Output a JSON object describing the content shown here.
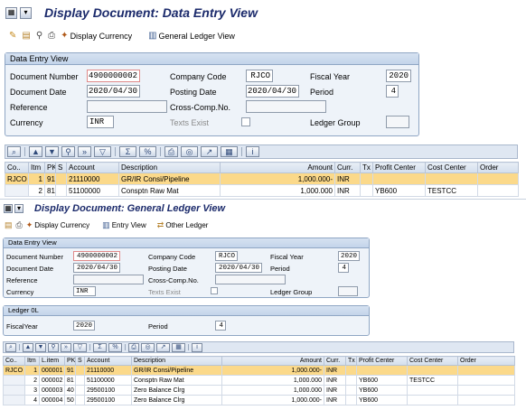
{
  "screen1": {
    "title": "Display Document: Data Entry View",
    "toolbar": {
      "display_currency": "Display Currency",
      "general_ledger_view": "General Ledger View"
    },
    "frame_title": "Data Entry View",
    "labels": {
      "document_number": "Document Number",
      "company_code": "Company Code",
      "fiscal_year": "Fiscal Year",
      "document_date": "Document Date",
      "posting_date": "Posting Date",
      "period": "Period",
      "reference": "Reference",
      "cross_comp": "Cross-Comp.No.",
      "currency": "Currency",
      "texts_exist": "Texts Exist",
      "ledger_group": "Ledger Group"
    },
    "values": {
      "document_number": "4900000002",
      "company_code": "RJCO",
      "fiscal_year": "2020",
      "document_date": "2020/04/30",
      "posting_date": "2020/04/30",
      "period": "4",
      "reference": "",
      "cross_comp": "",
      "currency": "INR",
      "ledger_group": ""
    },
    "grid": {
      "headers": [
        "Co..",
        "Itm",
        "PK",
        "S",
        "Account",
        "Description",
        "Amount",
        "Curr.",
        "Tx",
        "Profit Center",
        "Cost Center",
        "Order"
      ],
      "rows": [
        [
          "RJCO",
          "1",
          "91",
          "",
          "21110000",
          "GR/IR Consi/Pipeline",
          "1,000.000-",
          "INR",
          "",
          "",
          "",
          ""
        ],
        [
          "",
          "2",
          "81",
          "",
          "51100000",
          "Consptn Raw Mat",
          "1,000.000",
          "INR",
          "",
          "YB600",
          "TESTCC",
          ""
        ]
      ]
    }
  },
  "screen2": {
    "title": "Display Document: General Ledger View",
    "toolbar": {
      "display_currency": "Display Currency",
      "entry_view": "Entry View",
      "other_ledger": "Other Ledger"
    },
    "frame_title": "Data Entry View",
    "labels": {
      "document_number": "Document Number",
      "company_code": "Company Code",
      "fiscal_year": "Fiscal Year",
      "document_date": "Document Date",
      "posting_date": "Posting Date",
      "period": "Period",
      "reference": "Reference",
      "cross_comp": "Cross-Comp.No.",
      "currency": "Currency",
      "texts_exist": "Texts Exist",
      "ledger_group": "Ledger Group"
    },
    "values": {
      "document_number": "4900000002",
      "company_code": "RJCO",
      "fiscal_year": "2020",
      "document_date": "2020/04/30",
      "posting_date": "2020/04/30",
      "period": "4",
      "reference": "",
      "cross_comp": "",
      "currency": "INR",
      "ledger_group": ""
    },
    "ledger_frame": {
      "title": "Ledger 0L",
      "fiscal_year_label": "FiscalYear",
      "fiscal_year": "2020",
      "period_label": "Period",
      "period": "4"
    },
    "grid": {
      "headers": [
        "Co..",
        "Itm",
        "L.item",
        "PK",
        "S",
        "Account",
        "Description",
        "Amount",
        "Curr.",
        "Tx",
        "Profit Center",
        "Cost Center",
        "Order"
      ],
      "rows": [
        [
          "RJCO",
          "1",
          "000001",
          "91",
          "",
          "21110000",
          "GR/IR Consi/Pipeline",
          "1,000.000-",
          "INR",
          "",
          "",
          "",
          ""
        ],
        [
          "",
          "2",
          "000002",
          "81",
          "",
          "51100000",
          "Consptn Raw Mat",
          "1,000.000",
          "INR",
          "",
          "YB600",
          "TESTCC",
          ""
        ],
        [
          "",
          "3",
          "000003",
          "40",
          "",
          "29500100",
          "Zero Balance Clrg",
          "1,000.000",
          "INR",
          "",
          "YB600",
          "",
          ""
        ],
        [
          "",
          "4",
          "000004",
          "50",
          "",
          "29500100",
          "Zero Balance Clrg",
          "1,000.000-",
          "INR",
          "",
          "YB600",
          "",
          ""
        ]
      ]
    }
  }
}
